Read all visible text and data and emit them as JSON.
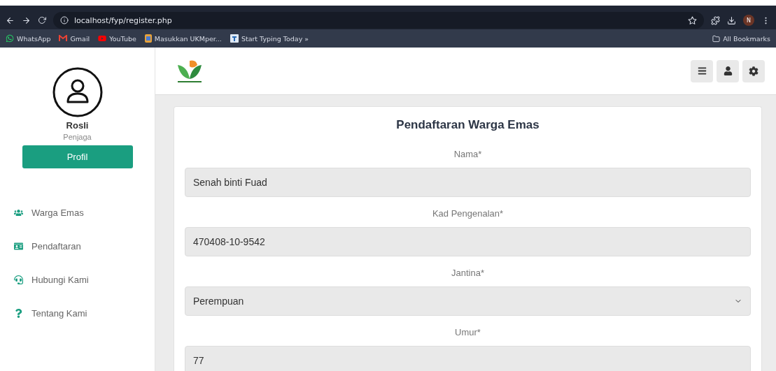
{
  "browser": {
    "url": "localhost/fyp/register.php",
    "profile_initial": "N",
    "bookmarks": [
      {
        "kind": "whatsapp",
        "label": "WhatsApp"
      },
      {
        "kind": "gmail",
        "label": "Gmail"
      },
      {
        "kind": "youtube",
        "label": "YouTube"
      },
      {
        "kind": "page",
        "label": "Masukkan UKMper..."
      },
      {
        "kind": "typing",
        "label": "Start Typing Today »"
      }
    ],
    "all_bookmarks": "All Bookmarks"
  },
  "sidebar": {
    "user_name": "Rosli",
    "user_role": "Penjaga",
    "profile_button": "Profil",
    "items": [
      {
        "kind": "users",
        "label": "Warga Emas"
      },
      {
        "kind": "card",
        "label": "Pendaftaran"
      },
      {
        "kind": "headset",
        "label": "Hubungi Kami"
      },
      {
        "kind": "question",
        "label": "Tentang Kami"
      }
    ]
  },
  "form": {
    "title": "Pendaftaran Warga Emas",
    "fields": [
      {
        "kind": "text",
        "label": "Nama*",
        "value": "Senah binti Fuad"
      },
      {
        "kind": "text",
        "label": "Kad Pengenalan*",
        "value": "470408-10-9542"
      },
      {
        "kind": "select",
        "label": "Jantina*",
        "value": "Perempuan"
      },
      {
        "kind": "text",
        "label": "Umur*",
        "value": "77"
      }
    ]
  }
}
